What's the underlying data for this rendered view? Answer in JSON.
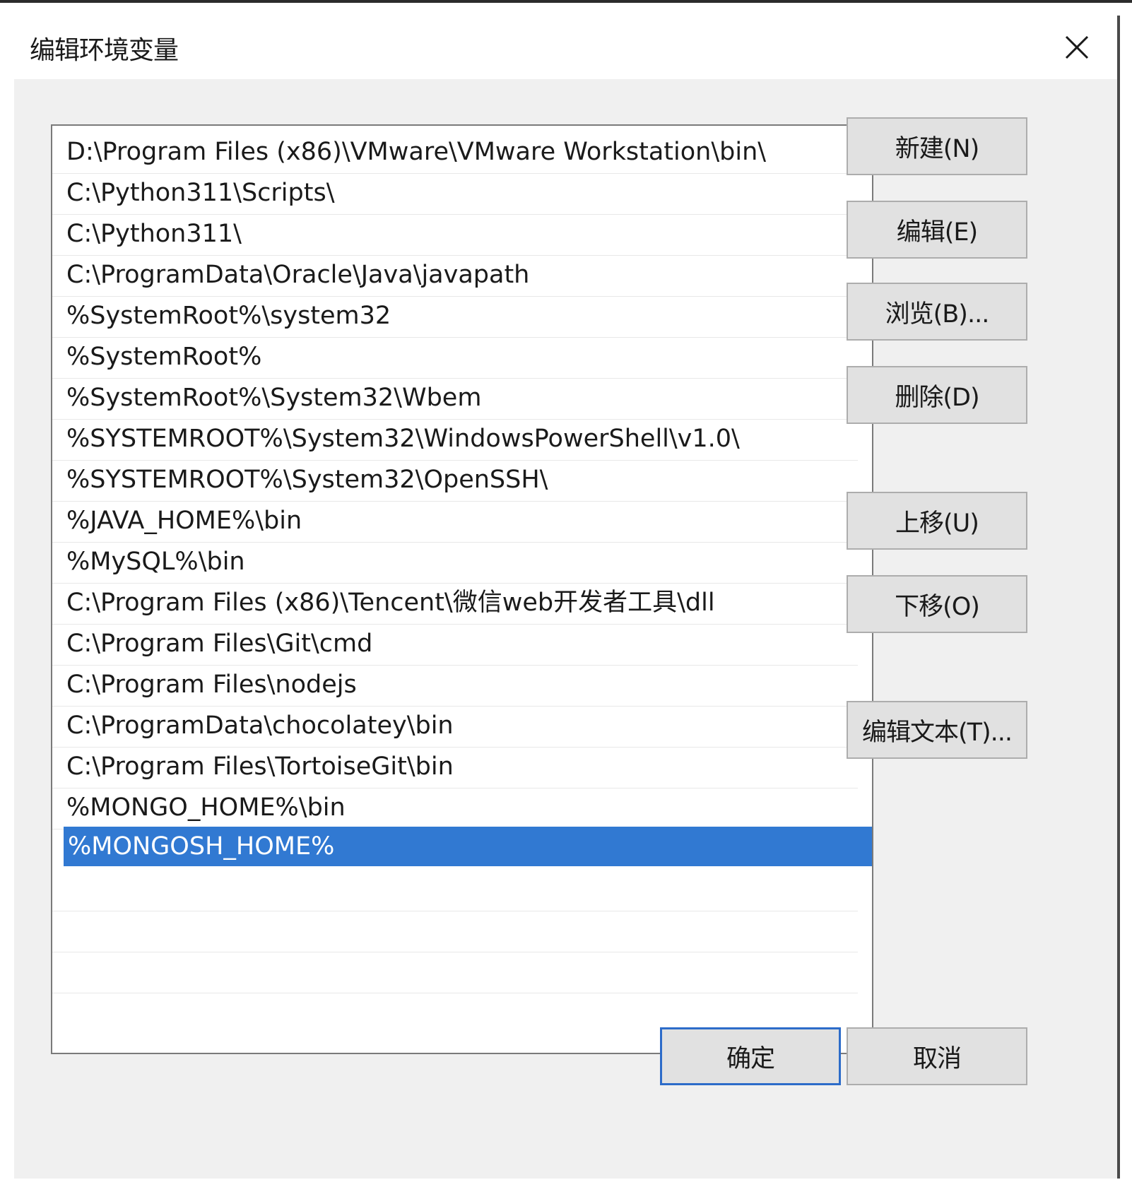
{
  "dialog": {
    "title": "编辑环境变量"
  },
  "path_entries": [
    "D:\\Program Files (x86)\\VMware\\VMware Workstation\\bin\\",
    "C:\\Python311\\Scripts\\",
    "C:\\Python311\\",
    "C:\\ProgramData\\Oracle\\Java\\javapath",
    "%SystemRoot%\\system32",
    "%SystemRoot%",
    "%SystemRoot%\\System32\\Wbem",
    "%SYSTEMROOT%\\System32\\WindowsPowerShell\\v1.0\\",
    "%SYSTEMROOT%\\System32\\OpenSSH\\",
    "%JAVA_HOME%\\bin",
    "%MySQL%\\bin",
    "C:\\Program Files (x86)\\Tencent\\微信web开发者工具\\dll",
    "C:\\Program Files\\Git\\cmd",
    "C:\\Program Files\\nodejs",
    "C:\\ProgramData\\chocolatey\\bin",
    "C:\\Program Files\\TortoiseGit\\bin",
    "%MONGO_HOME%\\bin",
    "%MONGOSH_HOME%"
  ],
  "selected_index": 17,
  "buttons": {
    "new": "新建(N)",
    "edit": "编辑(E)",
    "browse": "浏览(B)...",
    "delete": "删除(D)",
    "move_up": "上移(U)",
    "move_down": "下移(O)",
    "edit_text": "编辑文本(T)...",
    "ok": "确定",
    "cancel": "取消"
  },
  "icons": {
    "close": "close-icon"
  },
  "colors": {
    "selection": "#3179d2",
    "default_button_border": "#2d6cc9"
  }
}
